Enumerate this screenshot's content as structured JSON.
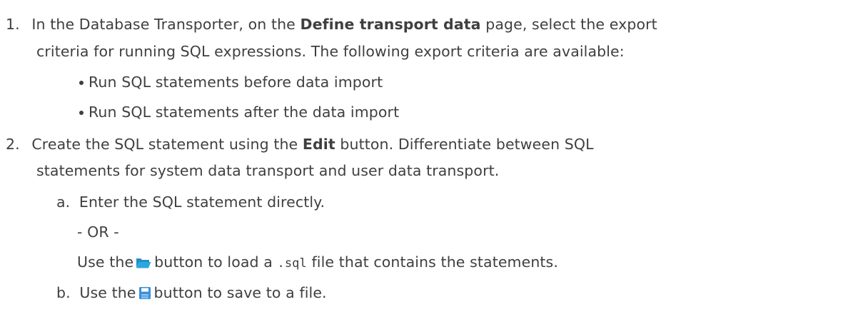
{
  "steps": [
    {
      "number": "1.",
      "line1_a": "In the Database Transporter, on the ",
      "line1_bold": "Define transport data",
      "line1_b": " page, select the export",
      "line2": "criteria for running SQL expressions. The following export criteria are available:",
      "bullets": [
        "Run SQL statements before data import",
        "Run SQL statements after the data import"
      ]
    },
    {
      "number": "2.",
      "line1_a": "Create the SQL statement using the ",
      "line1_bold": "Edit",
      "line1_b": " button. Differentiate between SQL",
      "line2": "statements for system data transport and user data transport.",
      "substeps": [
        {
          "letter": "a.",
          "text": "Enter the SQL statement directly.",
          "or_text": "- OR -",
          "use_a": "Use the",
          "use_b": "button to load a ",
          "use_code": ".sql",
          "use_c": " file that contains the statements."
        },
        {
          "letter": "b.",
          "use_a": "Use the",
          "use_b": "button to save to a file."
        }
      ]
    }
  ],
  "icons": {
    "open": "folder-open-icon",
    "save": "save-icon"
  },
  "colors": {
    "text": "#3f3f3f",
    "folder": "#2aa7e0",
    "save": "#3a8fd9"
  }
}
